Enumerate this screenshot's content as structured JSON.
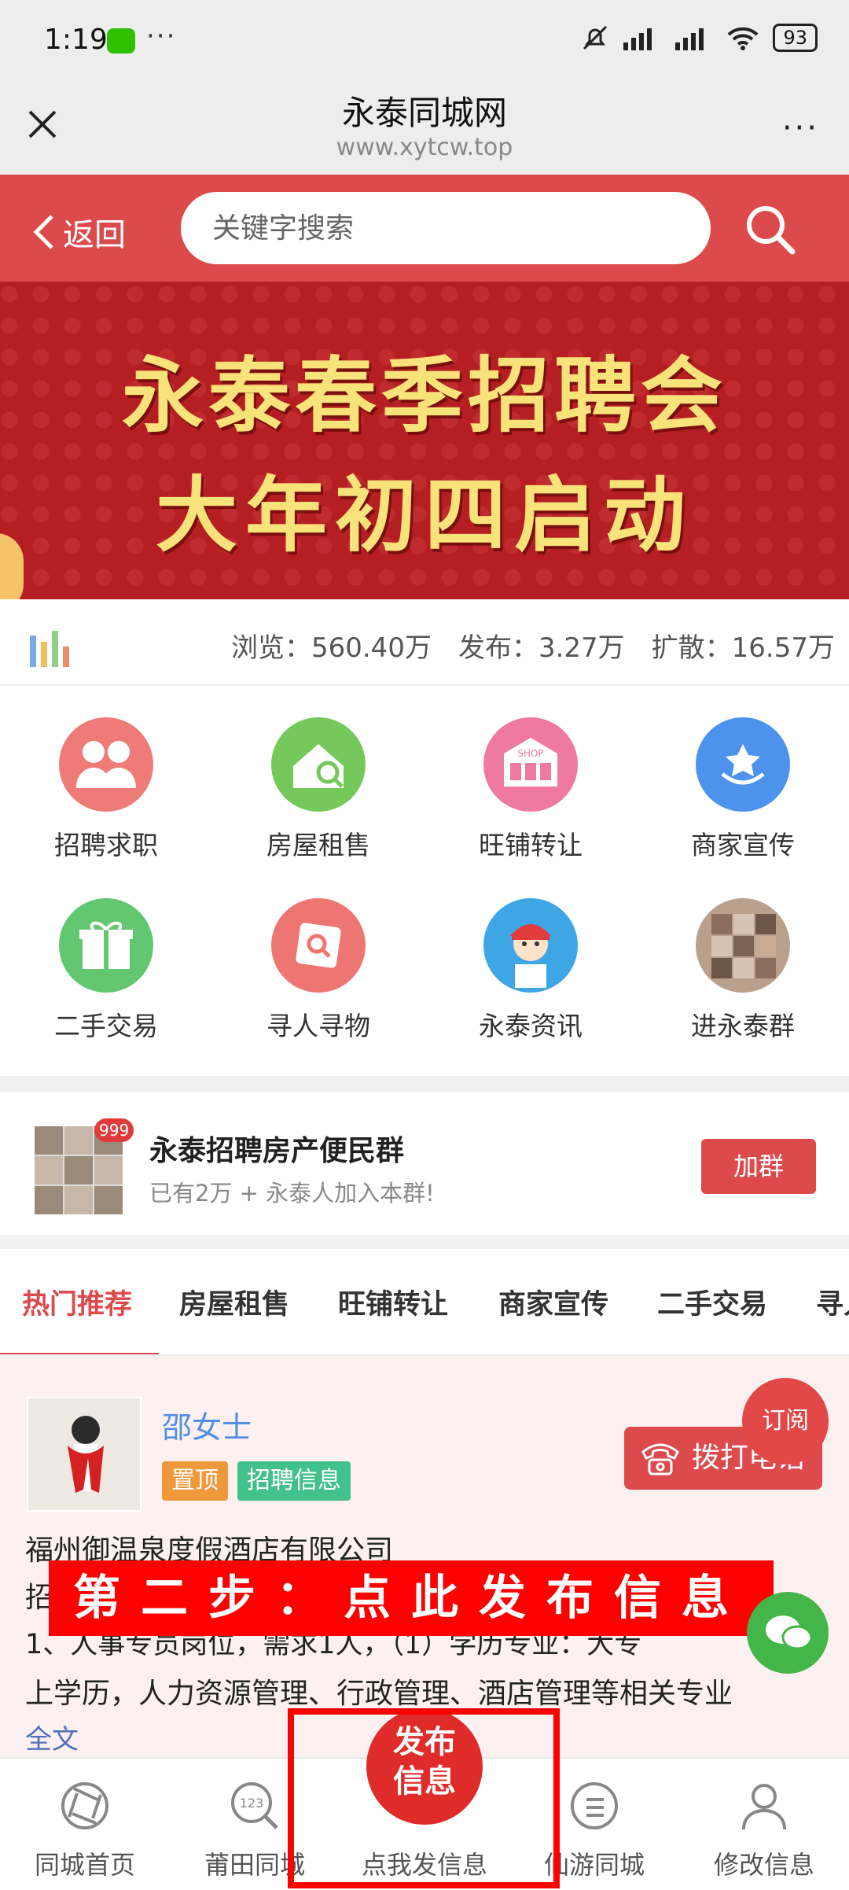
{
  "status_bar": {
    "time": "1:19",
    "battery": "93",
    "dots": "···"
  },
  "titlebar": {
    "title": "永泰同城网",
    "url": "www.xytcw.top",
    "more": "···"
  },
  "header": {
    "back_label": "返回",
    "search_placeholder": "关键字搜索"
  },
  "banner": {
    "line1": "永泰春季招聘会",
    "line2": "大年初四启动"
  },
  "stats": {
    "views": "浏览：560.40万",
    "posts": "发布：3.27万",
    "shares": "扩散：16.57万"
  },
  "categories": [
    {
      "label": "招聘求职",
      "icon": "job-seek-icon",
      "color": "#ee7b78"
    },
    {
      "label": "房屋租售",
      "icon": "house-search-icon",
      "color": "#75c95a"
    },
    {
      "label": "旺铺转让",
      "icon": "shop-icon",
      "color": "#ee7aa2"
    },
    {
      "label": "商家宣传",
      "icon": "merchant-icon",
      "color": "#4d93ee"
    },
    {
      "label": "二手交易",
      "icon": "gift-icon",
      "color": "#63c670"
    },
    {
      "label": "寻人寻物",
      "icon": "search-person-icon",
      "color": "#ee7672"
    },
    {
      "label": "永泰资讯",
      "icon": "news-avatar-icon",
      "color": "#3fa6e6"
    },
    {
      "label": "进永泰群",
      "icon": "group-photo-icon",
      "color": "#b9a08c"
    }
  ],
  "promo": {
    "badge": "999",
    "title": "永泰招聘房产便民群",
    "subtitle": "已有2万 + 永泰人加入本群!",
    "join_label": "加群"
  },
  "tabs": [
    "热门推荐",
    "房屋租售",
    "旺铺转让",
    "商家宣传",
    "二手交易",
    "寻人"
  ],
  "post": {
    "name": "邵女士",
    "tag_top": "置顶",
    "tag_job": "招聘信息",
    "call_label": "拨打电话",
    "subscribe_label": "订阅",
    "company": "福州御温泉度假酒店有限公司",
    "line1": "招",
    "line2": "1、人事专员岗位，需求1人，（1）学历专业：大专",
    "line3": "上学历，人力资源管理、行政管理、酒店管理等相关专业",
    "full_text": "全文"
  },
  "overlay": {
    "text": "第二步：点此发布信息"
  },
  "bottom_nav": {
    "items": [
      {
        "label": "同城首页",
        "icon": "home-aperture-icon"
      },
      {
        "label": "莆田同城",
        "icon": "search-123-icon"
      },
      {
        "label": "点我发信息",
        "icon": "publish-icon"
      },
      {
        "label": "仙游同城",
        "icon": "list-circle-icon"
      },
      {
        "label": "修改信息",
        "icon": "user-icon"
      }
    ],
    "publish_line1": "发布",
    "publish_line2": "信息"
  },
  "colors": {
    "brand_red": "#dc4a4c",
    "banner_red": "#b51e22",
    "link_blue": "#4f8fe6",
    "highlight_red": "#ff0000"
  }
}
